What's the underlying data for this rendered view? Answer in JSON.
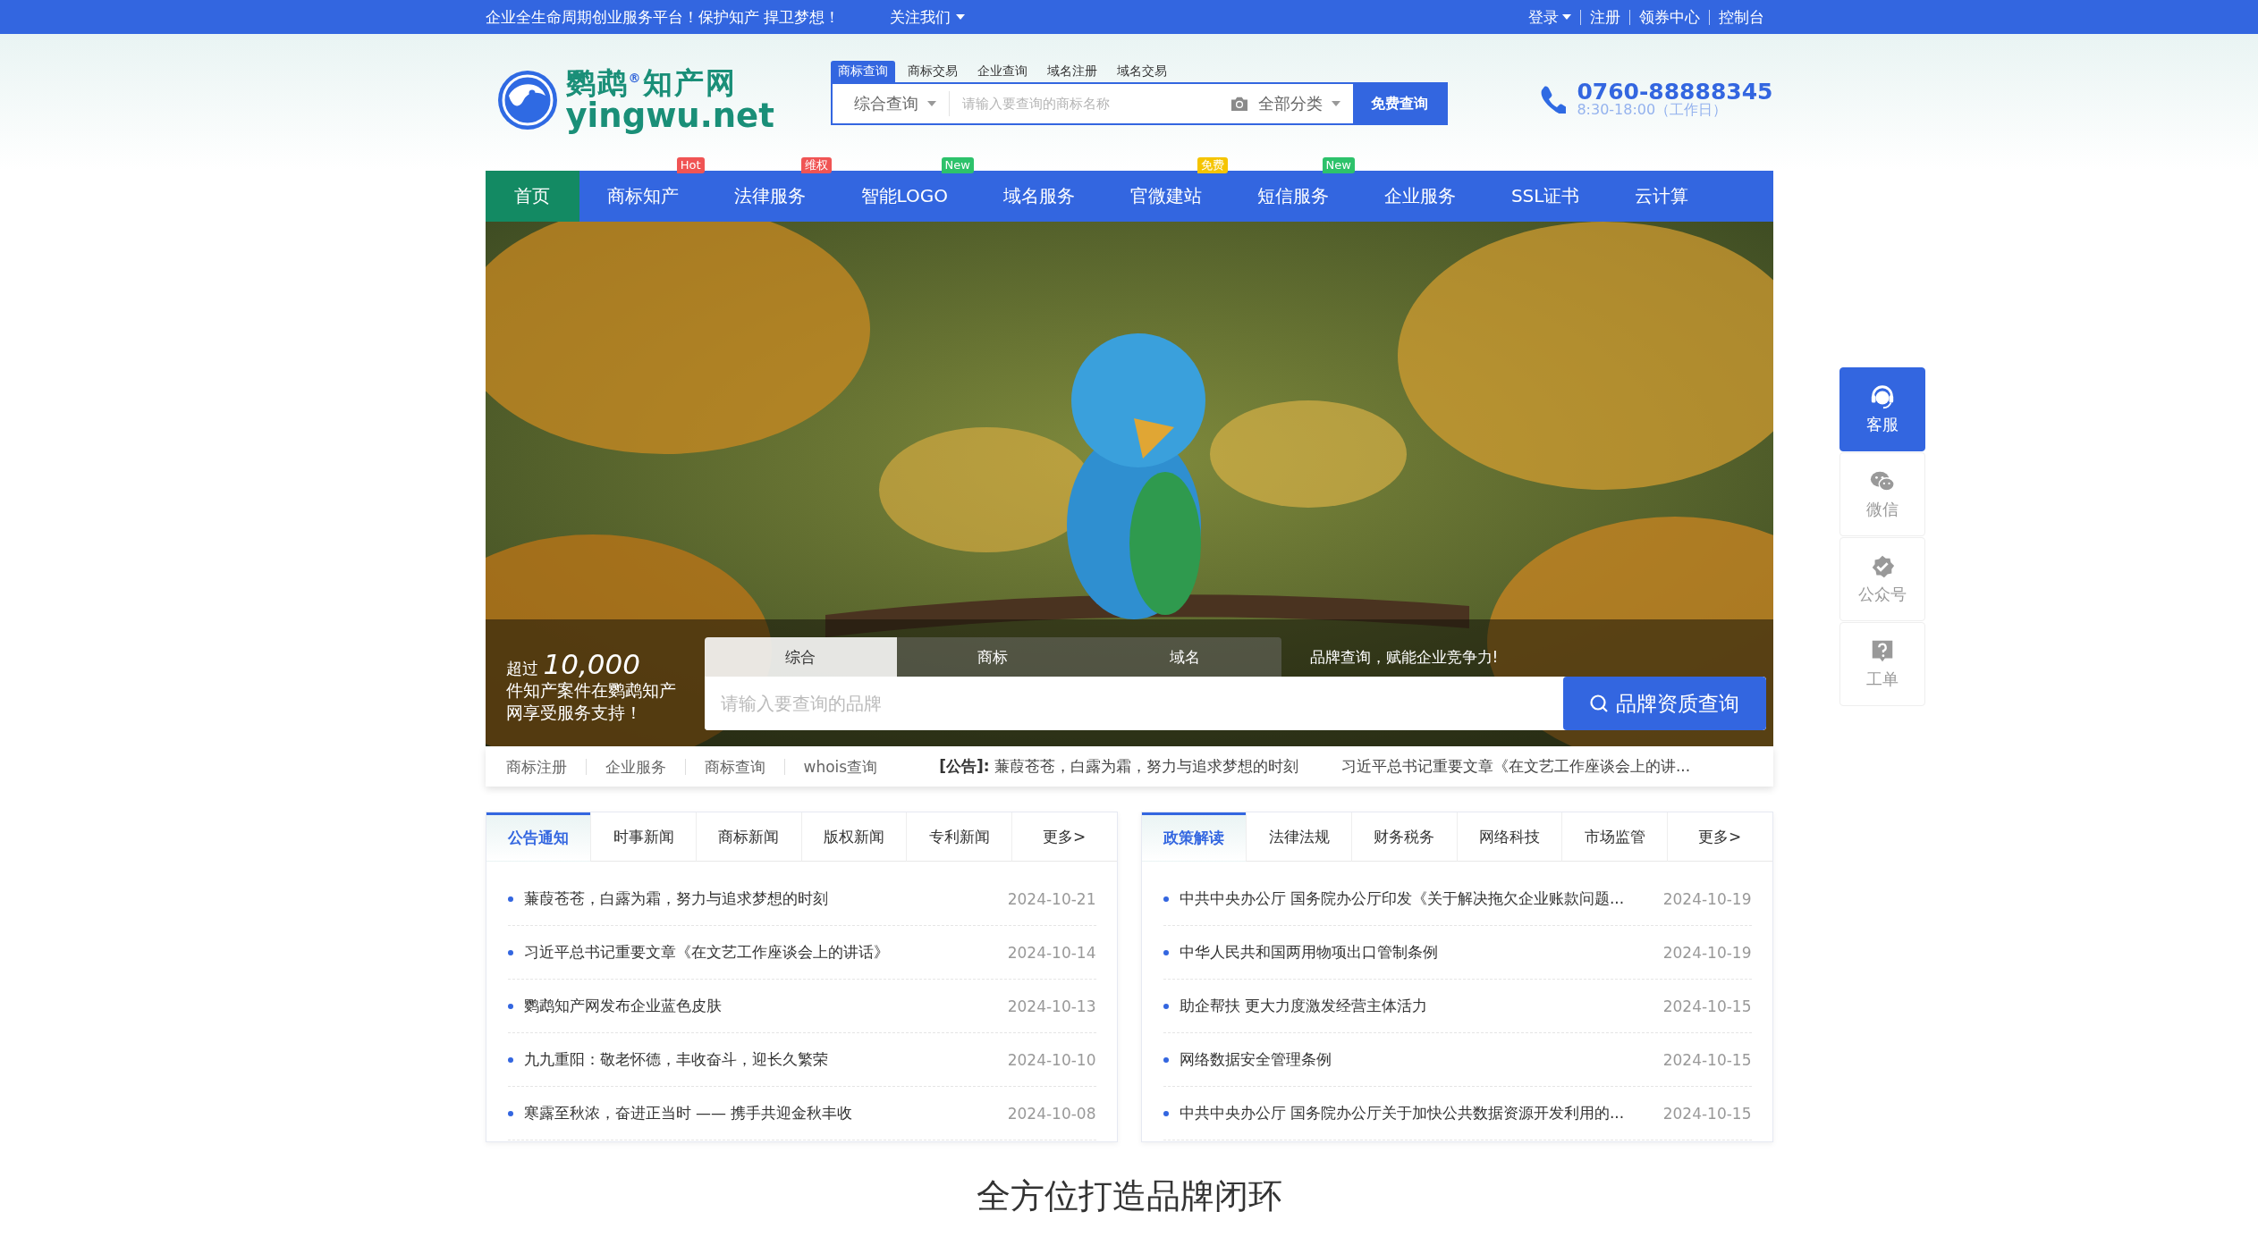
{
  "top_bar": {
    "slogan": "企业全生命周期创业服务平台！保护知产 捍卫梦想！",
    "follow": "关注我们",
    "login": "登录",
    "links": [
      "注册",
      "领券中心",
      "控制台"
    ]
  },
  "header": {
    "logo": {
      "name": "鹦鹉$^{®}$知产网",
      "domain": "yingwu.net"
    },
    "search": {
      "tabs": [
        {
          "label": "商标查询",
          "selected": true
        },
        {
          "label": "商标交易",
          "selected": false
        },
        {
          "label": "企业查询",
          "selected": false
        },
        {
          "label": "域名注册",
          "selected": false
        },
        {
          "label": "域名交易",
          "selected": false
        }
      ],
      "scope": "综合查询",
      "placeholder": "请输入要查询的商标名称",
      "category": "全部分类",
      "button": "免费查询"
    },
    "phone": {
      "number": "0760-88888345",
      "hours": "8:30-18:00（工作日）"
    }
  },
  "nav": [
    {
      "label": "首页",
      "selected": true
    },
    {
      "label": "商标知产",
      "selected": false,
      "badge": {
        "text": "Hot",
        "color": "#f05454"
      }
    },
    {
      "label": "法律服务",
      "selected": false,
      "badge": {
        "text": "维权",
        "color": "#f05454"
      }
    },
    {
      "label": "智能LOGO",
      "selected": false,
      "badge": {
        "text": "New",
        "color": "#2dc26b"
      }
    },
    {
      "label": "域名服务",
      "selected": false
    },
    {
      "label": "官微建站",
      "selected": false,
      "badge": {
        "text": "免费",
        "color": "#f5c400"
      }
    },
    {
      "label": "短信服务",
      "selected": false,
      "badge": {
        "text": "New",
        "color": "#2dc26b"
      }
    },
    {
      "label": "企业服务",
      "selected": false
    },
    {
      "label": "SSL证书",
      "selected": false
    },
    {
      "label": "云计算",
      "selected": false
    }
  ],
  "banner": {
    "stat_prefix": "超过",
    "stat_value": "10,000",
    "stat_text": "件知产案件在鹦鹉知产网享受服务支持！",
    "tabs": [
      {
        "label": "综合",
        "selected": true
      },
      {
        "label": "商标",
        "selected": false
      },
      {
        "label": "域名",
        "selected": false
      }
    ],
    "slogan": "品牌查询，赋能企业竞争力!",
    "placeholder": "请输入要查询的品牌",
    "button": "品牌资质查询"
  },
  "ticker": {
    "links": [
      "商标注册",
      "企业服务",
      "商标查询",
      "whois查询"
    ],
    "notices": [
      "**[公告]:** 蒹葭苍苍，白露为霜，努力与追求梦想的时刻",
      "习近平总书记重要文章《在文艺工作座谈会上的讲..."
    ]
  },
  "news_panels": [
    {
      "tabs": [
        {
          "label": "公告通知",
          "selected": true
        },
        {
          "label": "时事新闻",
          "selected": false
        },
        {
          "label": "商标新闻",
          "selected": false
        },
        {
          "label": "版权新闻",
          "selected": false
        },
        {
          "label": "专利新闻",
          "selected": false
        }
      ],
      "more": "更多>",
      "items": [
        {
          "title": "蒹葭苍苍，白露为霜，努力与追求梦想的时刻",
          "date": "2024-10-21"
        },
        {
          "title": "习近平总书记重要文章《在文艺工作座谈会上的讲话》",
          "date": "2024-10-14"
        },
        {
          "title": "鹦鹉知产网发布企业蓝色皮肤",
          "date": "2024-10-13"
        },
        {
          "title": "九九重阳：敬老怀德，丰收奋斗，迎长久繁荣",
          "date": "2024-10-10"
        },
        {
          "title": "寒露至秋浓，奋进正当时 —— 携手共迎金秋丰收",
          "date": "2024-10-08"
        }
      ]
    },
    {
      "tabs": [
        {
          "label": "政策解读",
          "selected": true
        },
        {
          "label": "法律法规",
          "selected": false
        },
        {
          "label": "财务税务",
          "selected": false
        },
        {
          "label": "网络科技",
          "selected": false
        },
        {
          "label": "市场监管",
          "selected": false
        }
      ],
      "more": "更多>",
      "items": [
        {
          "title": "中共中央办公厅 国务院办公厅印发《关于解决拖欠企业账款问题...",
          "date": "2024-10-19"
        },
        {
          "title": "中华人民共和国两用物项出口管制条例",
          "date": "2024-10-19"
        },
        {
          "title": "助企帮扶 更大力度激发经营主体活力",
          "date": "2024-10-15"
        },
        {
          "title": "网络数据安全管理条例",
          "date": "2024-10-15"
        },
        {
          "title": "中共中央办公厅 国务院办公厅关于加快公共数据资源开发利用的...",
          "date": "2024-10-15"
        }
      ]
    }
  ],
  "section_title": "全方位打造品牌闭环",
  "side_tools": [
    {
      "label": "客服",
      "kind": "headset",
      "selected": true
    },
    {
      "label": "微信",
      "kind": "wechat",
      "selected": false
    },
    {
      "label": "公众号",
      "kind": "badge",
      "selected": false
    },
    {
      "label": "工单",
      "kind": "question",
      "selected": false
    }
  ]
}
